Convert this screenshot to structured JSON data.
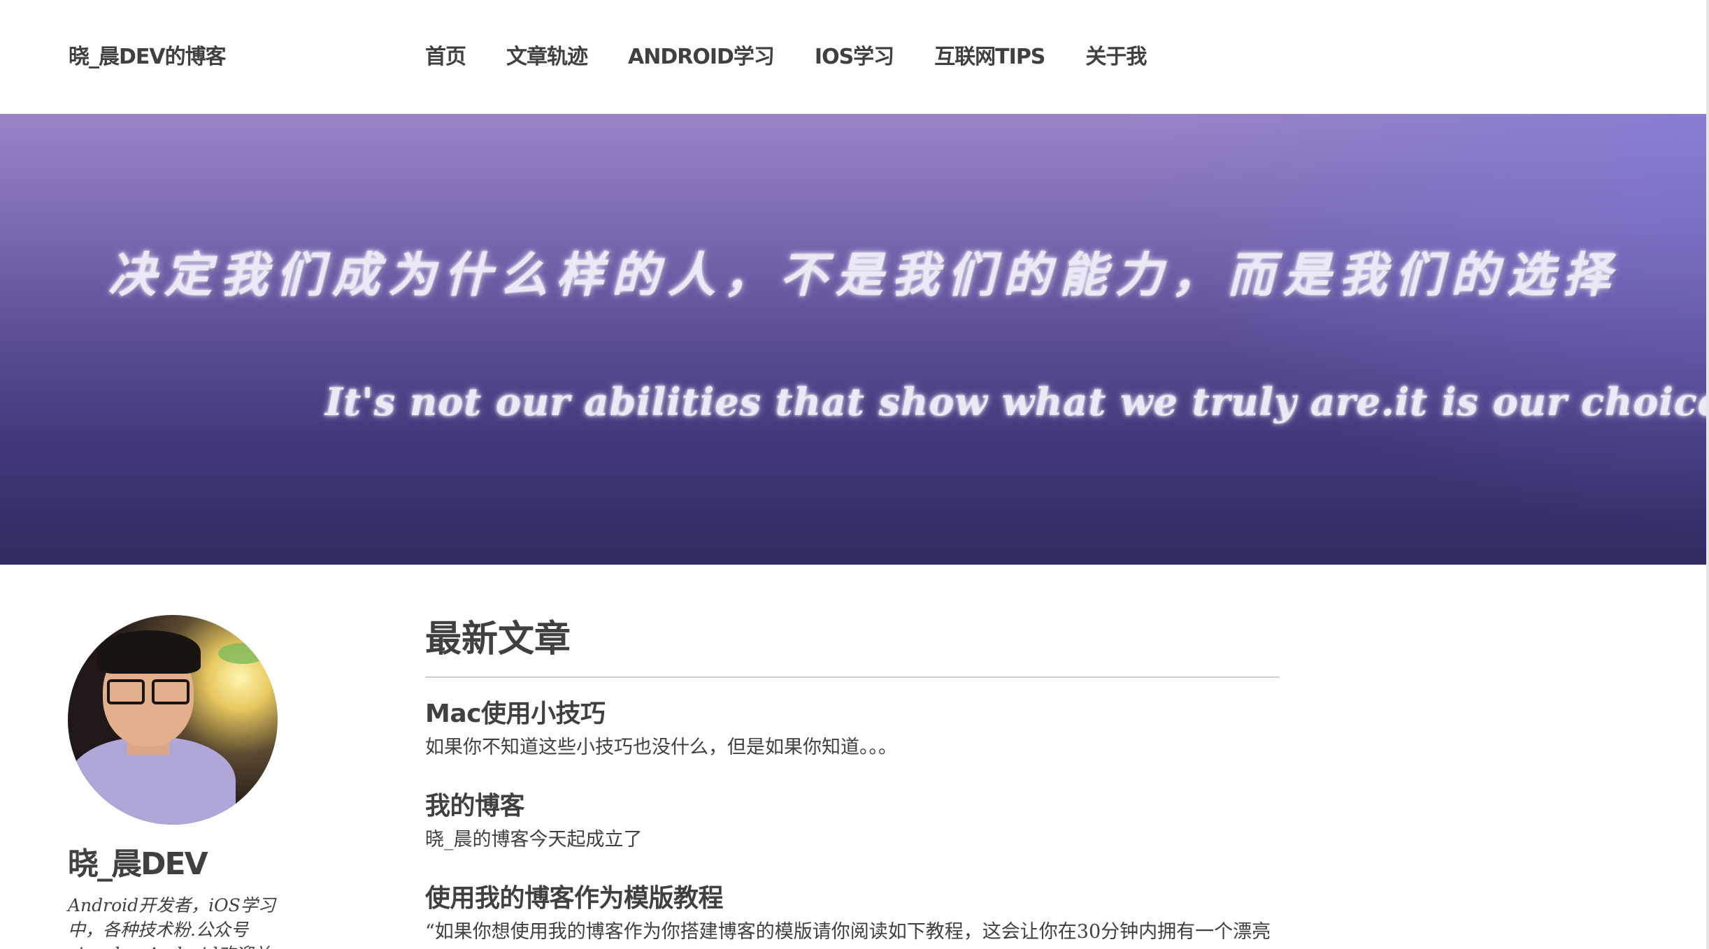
{
  "header": {
    "brand": "晓_晨DEV的博客",
    "nav": [
      "首页",
      "文章轨迹",
      "ANDROID学习",
      "IOS学习",
      "互联网TIPS",
      "关于我"
    ]
  },
  "banner": {
    "quote_cn": "决定我们成为什么样的人，不是我们的能力，而是我们的选择",
    "quote_en": "It's not our abilities that show what we truly are.it is our choices"
  },
  "sidebar": {
    "author_name": "晓_晨DEV",
    "bio": "Android开发者，iOS学习中，各种技术粉.公众号xiaochenAndroid欢迎关注"
  },
  "main": {
    "section_title": "最新文章",
    "posts": [
      {
        "title": "Mac使用小技巧",
        "excerpt": "如果你不知道这些小技巧也没什么，但是如果你知道。。。"
      },
      {
        "title": "我的博客",
        "excerpt": "晓_晨的博客今天起成立了"
      },
      {
        "title": "使用我的博客作为模版教程",
        "excerpt": "“如果你想使用我的博客作为你搭建博客的模版请你阅读如下教程，这会让你在30分钟内拥有一个漂亮的博客”"
      }
    ]
  },
  "colors": {
    "banner_top": "#9a84c6",
    "banner_bottom": "#2f2b60",
    "text": "#404040"
  }
}
